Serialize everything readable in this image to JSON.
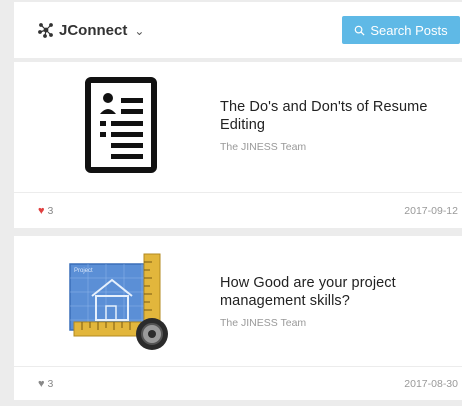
{
  "header": {
    "brand": "JConnect",
    "search_label": "Search Posts"
  },
  "colors": {
    "accent": "#5fb9e6",
    "like_active": "#e04040",
    "like_inactive": "#888888"
  },
  "posts": [
    {
      "title": "The Do's and Don'ts of Resume Editing",
      "author": "The JINESS Team",
      "likes": "3",
      "liked": true,
      "date": "2017-09-12",
      "thumbnail_icon": "resume-document-icon"
    },
    {
      "title": "How Good are your project management skills?",
      "author": "The JINESS Team",
      "likes": "3",
      "liked": false,
      "date": "2017-08-30",
      "thumbnail_icon": "project-blueprint-icon",
      "thumbnail_text": "Project"
    }
  ]
}
